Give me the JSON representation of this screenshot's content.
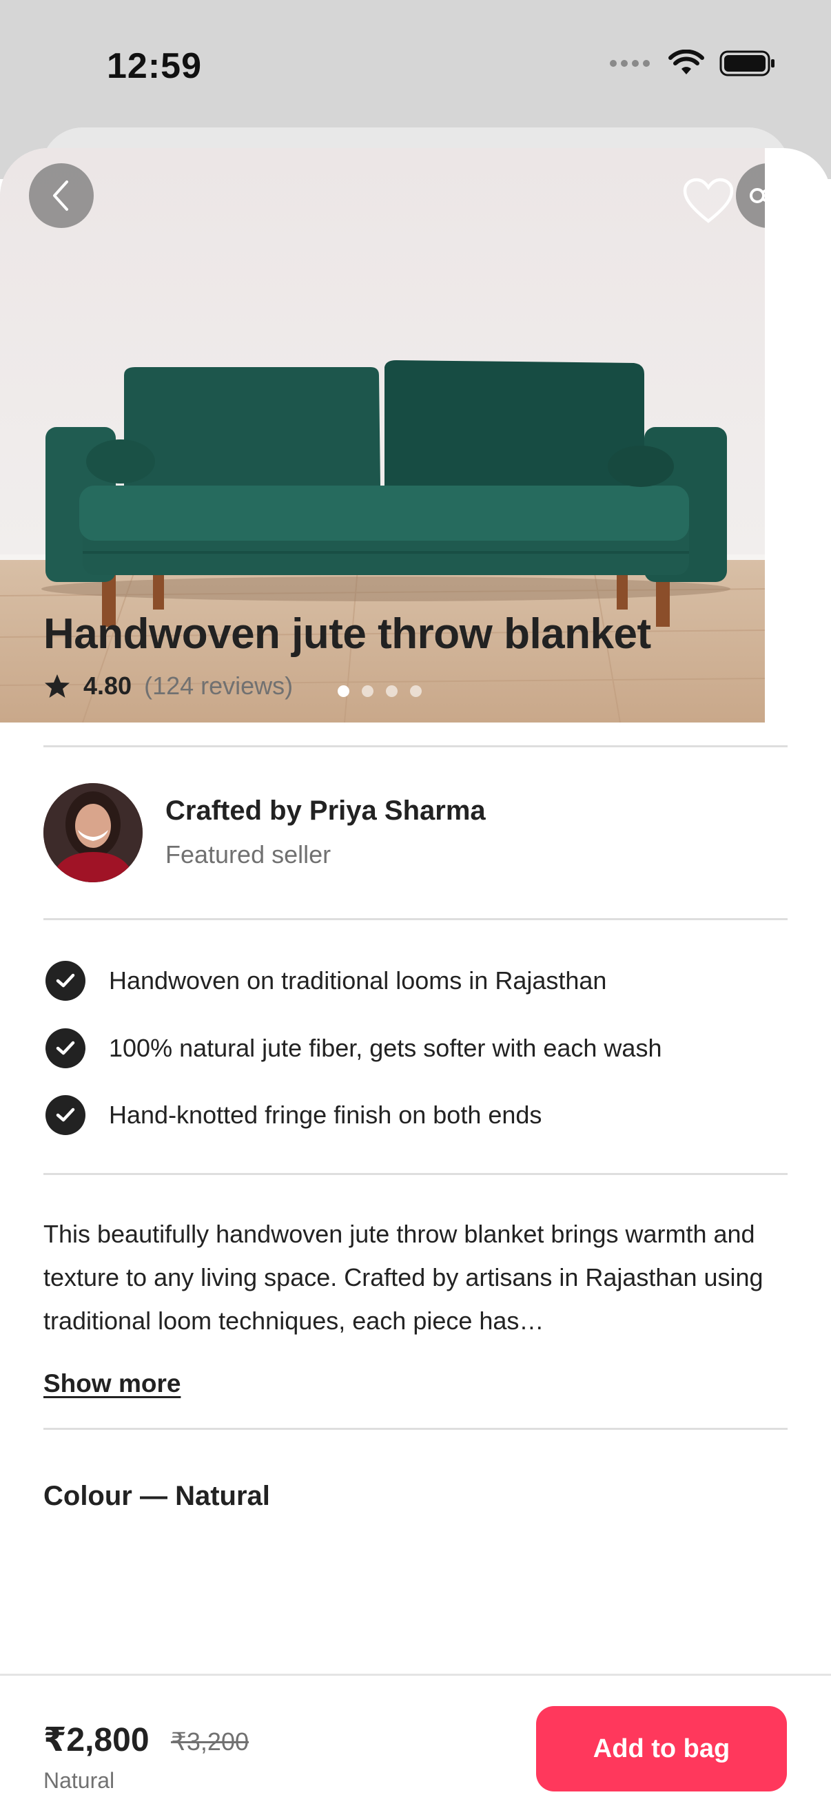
{
  "status_bar": {
    "time": "12:59"
  },
  "hero": {
    "image_alt": "Green velvet sofa",
    "slide_count": 4,
    "active_slide": 0
  },
  "product": {
    "title": "Handwoven jute throw blanket",
    "rating": "4.80",
    "reviews": "(124 reviews)"
  },
  "seller": {
    "name": "Crafted by Priya Sharma",
    "subtitle": "Featured seller"
  },
  "features": [
    "Handwoven on traditional looms in Rajasthan",
    "100% natural jute fiber, gets softer with each wash",
    "Hand-knotted fringe finish on both ends"
  ],
  "description": {
    "text": "This beautifully handwoven jute throw blanket brings warmth and texture to any living space. Crafted by artisans in Rajasthan using traditional loom techniques, each piece has…",
    "show_more": "Show more"
  },
  "colour": {
    "label": "Colour — Natural"
  },
  "purchase": {
    "price": "₹2,800",
    "old_price": "₹3,200",
    "variant": "Natural",
    "cta": "Add to bag"
  },
  "colors": {
    "accent": "#ff385c",
    "text": "#222222",
    "muted": "#717171"
  }
}
